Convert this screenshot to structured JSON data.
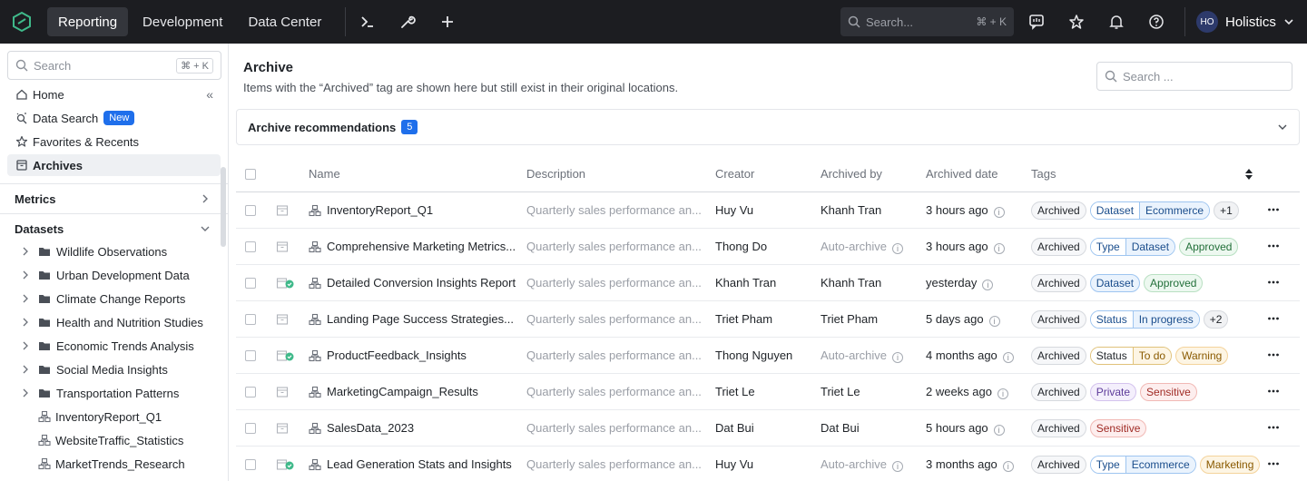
{
  "topbar": {
    "tabs": [
      "Reporting",
      "Development",
      "Data Center"
    ],
    "search_placeholder": "Search...",
    "search_shortcut": "⌘ + K",
    "user_initials": "HO",
    "workspace": "Holistics"
  },
  "sidebar": {
    "search_placeholder": "Search",
    "search_shortcut": "⌘ + K",
    "nav": {
      "home": "Home",
      "data_search": "Data Search",
      "data_search_badge": "New",
      "favorites": "Favorites & Recents",
      "archives": "Archives"
    },
    "metrics_label": "Metrics",
    "datasets_label": "Datasets",
    "folders": [
      "Wildlife Observations",
      "Urban Development Data",
      "Climate Change Reports",
      "Health and Nutrition Studies",
      "Economic Trends Analysis",
      "Social Media Insights",
      "Transportation Patterns"
    ],
    "datasets": [
      "InventoryReport_Q1",
      "WebsiteTraffic_Statistics",
      "MarketTrends_Research"
    ]
  },
  "main": {
    "title": "Archive",
    "subtitle": "Items with the “Archived” tag are shown here but still exist in their original locations.",
    "search_placeholder": "Search ...",
    "recommendations_label": "Archive recommendations",
    "recommendations_count": "5",
    "columns": {
      "name": "Name",
      "description": "Description",
      "creator": "Creator",
      "archived_by": "Archived by",
      "archived_date": "Archived date",
      "tags": "Tags"
    },
    "rows": [
      {
        "name": "InventoryReport_Q1",
        "description": "Quarterly sales performance an...",
        "creator": "Huy Vu",
        "archived_by": "Khanh Tran",
        "date": "3 hours ago"
      },
      {
        "name": "Comprehensive Marketing Metrics...",
        "description": "Quarterly sales performance an...",
        "creator": "Thong Do",
        "archived_by": "Auto-archive",
        "date": "3 hours ago"
      },
      {
        "name": "Detailed Conversion Insights Report",
        "description": "Quarterly sales performance an...",
        "creator": "Khanh Tran",
        "archived_by": "Khanh Tran",
        "date": "yesterday"
      },
      {
        "name": "Landing Page Success Strategies...",
        "description": "Quarterly sales performance an...",
        "creator": "Triet Pham",
        "archived_by": "Triet Pham",
        "date": "5 days ago"
      },
      {
        "name": "ProductFeedback_Insights",
        "description": "Quarterly sales performance an...",
        "creator": "Thong Nguyen",
        "archived_by": "Auto-archive",
        "date": "4 months ago"
      },
      {
        "name": "MarketingCampaign_Results",
        "description": "Quarterly sales performance an...",
        "creator": "Triet Le",
        "archived_by": "Triet Le",
        "date": "2 weeks ago"
      },
      {
        "name": "SalesData_2023",
        "description": "Quarterly sales performance an...",
        "creator": "Dat Bui",
        "archived_by": "Dat Bui",
        "date": "5 hours ago"
      },
      {
        "name": "Lead Generation Stats and Insights",
        "description": "Quarterly sales performance an...",
        "creator": "Huy Vu",
        "archived_by": "Auto-archive",
        "date": "3 months ago"
      }
    ],
    "tags": {
      "archived": "Archived",
      "dataset": "Dataset",
      "ecommerce": "Ecommerce",
      "plus1": "+1",
      "type": "Type",
      "approved": "Approved",
      "status": "Status",
      "in_progress": "In progress",
      "plus2": "+2",
      "to_do": "To do",
      "warning": "Warning",
      "private": "Private",
      "sensitive": "Sensitive",
      "marketing": "Marketing"
    }
  },
  "colors": {
    "topbar_bg": "#1c1d21",
    "accent": "#1f6feb"
  }
}
